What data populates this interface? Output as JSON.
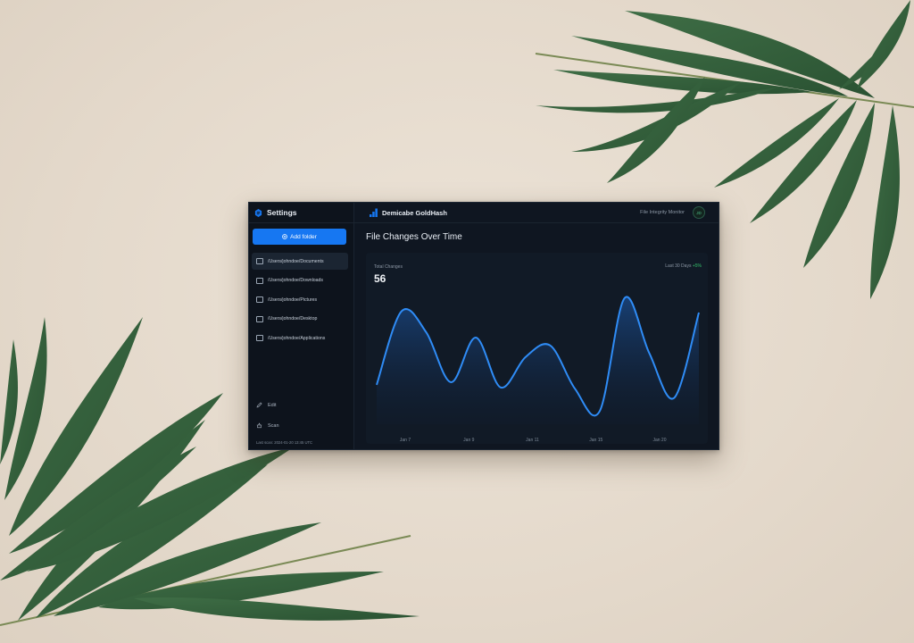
{
  "sidebar": {
    "title": "Settings",
    "add_button": "Add folder",
    "folders": [
      "/Users/johndoe/Documents",
      "/Users/johndoe/Downloads",
      "/Users/johndoe/Pictures",
      "/Users/johndoe/Desktop",
      "/Users/johndoe/Applications"
    ],
    "actions": {
      "edit": "Edit",
      "scan": "Scan"
    },
    "footer": "Last scan: 2024-01-20 13:45 UTC"
  },
  "topbar": {
    "app_title": "Demicabe GoldHash",
    "user": "File Integrity Monitor",
    "avatar_initials": "JD"
  },
  "main": {
    "page_title": "File Changes Over Time",
    "stat_label": "Total Changes",
    "stat_value": "56",
    "range_label": "Last 30 Days",
    "range_delta": "+5%"
  },
  "colors": {
    "accent": "#1677f2",
    "line": "#2f8cf6",
    "positive": "#35c26b"
  },
  "chart_data": {
    "type": "area",
    "x_ticks": [
      "Jan 7",
      "Jan 9",
      "Jan 11",
      "Jan 15",
      "Jan 20"
    ],
    "values": [
      3.0,
      8.6,
      7.0,
      3.2,
      6.6,
      2.8,
      5.1,
      6.0,
      2.7,
      1.0,
      9.6,
      5.4,
      2.0,
      8.5
    ],
    "ylim": [
      0,
      10
    ],
    "grid": false
  }
}
